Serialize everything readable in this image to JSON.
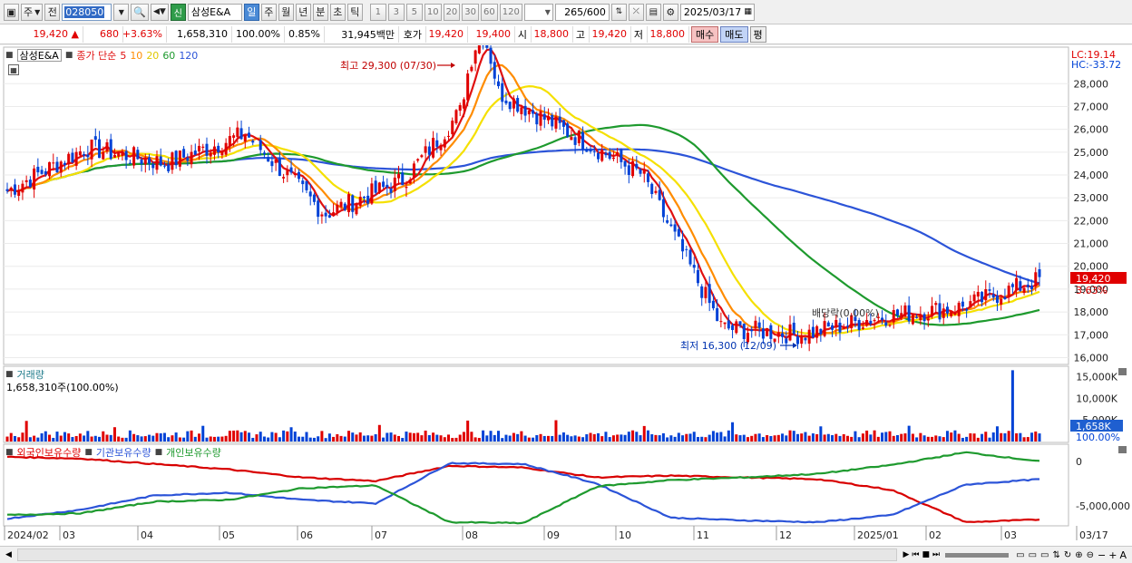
{
  "toolbar": {
    "market": "주",
    "type": "전",
    "code": "028050",
    "name": "삼성E&A",
    "badge": "신",
    "periods": [
      "일",
      "주",
      "월",
      "년",
      "분",
      "초",
      "틱"
    ],
    "intervals": [
      "1",
      "3",
      "5",
      "10",
      "20",
      "30",
      "60",
      "120"
    ],
    "count": "265",
    "count_total": "/600",
    "date": "2025/03/17"
  },
  "info": {
    "price": "19,420 ▲",
    "change": "680",
    "change_pct": "+3.63%",
    "volume": "1,658,310",
    "volume_pct": "100.00%",
    "turnover": "0.85%",
    "amount": "31,945백만",
    "bid_label": "호가",
    "bid_price": "19,420",
    "ask_price": "19,400",
    "open_label": "시",
    "open_price": "18,800",
    "high_label": "고",
    "high_price": "19,420",
    "low_label": "저",
    "low_price": "18,800",
    "buy_label": "매수",
    "sell_label": "매도",
    "flat_label": "평"
  },
  "price_chart": {
    "legend_name": "삼성E&A",
    "legend_prefix": "종가 단순",
    "ma_periods": [
      "5",
      "10",
      "20",
      "60",
      "120"
    ],
    "lc": "LC:19.14",
    "hc": "HC:-33.72",
    "y_labels": [
      "28,000",
      "27,000",
      "26,000",
      "25,000",
      "24,000",
      "23,000",
      "22,000",
      "21,000",
      "20,000",
      "19,000",
      "18,000",
      "17,000",
      "16,000"
    ],
    "current_price": "19,420",
    "current_pct": "3.63%",
    "annot_high": "최고 29,300 (07/30)",
    "annot_low": "최저 16,300 (12/09)",
    "annot_dividend": "배당락(0.00%)"
  },
  "volume_chart": {
    "title": "거래량",
    "value": "1,658,310주(100.00%)",
    "y_labels": [
      "15,000K",
      "10,000K",
      "5,000K"
    ],
    "current": "1,658K",
    "current_pct": "100.00%"
  },
  "holding_chart": {
    "legend": [
      "외국인보유수량",
      "기관보유수량",
      "개인보유수량"
    ],
    "y_labels": [
      "0",
      "-5,000,000"
    ]
  },
  "x_axis": {
    "labels": [
      "2024/02",
      "03",
      "04",
      "05",
      "06",
      "07",
      "08",
      "09",
      "10",
      "11",
      "12",
      "2025/01",
      "02",
      "03",
      "03/17"
    ]
  },
  "colors": {
    "up": "#e00000",
    "down": "#0042d6",
    "ma5": "#e01010",
    "ma10": "#ff8c00",
    "ma20": "#f5e000",
    "ma60": "#1e9a2e",
    "ma120": "#2c54d8"
  },
  "chart_data": {
    "type": "candlestick",
    "x": [
      "2024/02",
      "03",
      "04",
      "05",
      "06",
      "07",
      "08",
      "09",
      "10",
      "11",
      "12",
      "2025/01",
      "02",
      "03"
    ],
    "close_approx": [
      23300,
      25200,
      24500,
      25800,
      22300,
      23800,
      28000,
      26000,
      24000,
      17300,
      17000,
      17800,
      18200,
      19420
    ],
    "ylim": [
      15700,
      29600
    ],
    "high": 29300,
    "low": 16300
  }
}
